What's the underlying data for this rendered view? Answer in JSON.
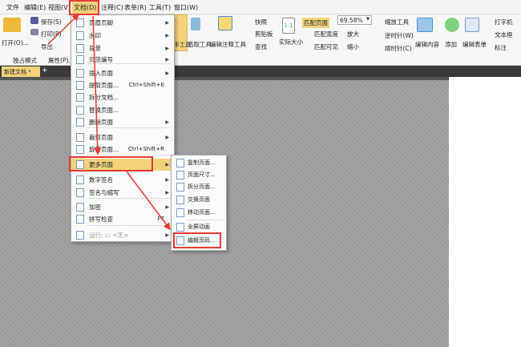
{
  "menubar": [
    "文件",
    "编辑(E)",
    "视图(V)",
    "文档(D)",
    "注释(C)",
    "表单(R)",
    "工具(T)",
    "窗口(W)"
  ],
  "ribbon": {
    "open": "打开(O)...",
    "save": "保存(S)",
    "print": "打印(P)",
    "export": "导出",
    "exclusive": "独占模式",
    "properties": "属性(P)...",
    "hand": "手工具",
    "select": "选取工具",
    "edit_annot": "编辑注释工具",
    "snapshot": "快照",
    "clipboard": "剪贴板",
    "find": "查找",
    "actual": "实际大小",
    "fit_page": "匹配页面",
    "fit_width": "匹配宽度",
    "fit_visible": "匹配可见",
    "zoom": "69.58%",
    "zoom_in": "放大",
    "zoom_out": "缩小",
    "zoom_tool": "缩放工具",
    "ccw": "逆时针(W)",
    "cw": "顺时针(C)",
    "edit_content": "编辑内容",
    "add": "添加",
    "edit_form": "编辑表单",
    "typewriter": "打字机",
    "textbox": "文本框",
    "callout": "标注"
  },
  "tab": {
    "label": "新建文档 *",
    "add": "+"
  },
  "doc_menu": [
    {
      "label": "页眉页脚",
      "arrow": true
    },
    {
      "label": "水印",
      "arrow": true
    },
    {
      "label": "背景",
      "arrow": true
    },
    {
      "label": "贝茨编号",
      "arrow": true
    },
    {
      "label": "插入页面",
      "arrow": true
    },
    {
      "label": "提取页面...",
      "shortcut": "Ctrl+Shift+E"
    },
    {
      "label": "拆分文档..."
    },
    {
      "label": "替换页面..."
    },
    {
      "label": "删除页面",
      "arrow": true
    },
    {
      "label": "裁剪页面",
      "arrow": true
    },
    {
      "label": "旋转页面...",
      "shortcut": "Ctrl+Shift+R"
    },
    {
      "label": "更多页面",
      "arrow": true
    },
    {
      "label": "数字签名",
      "arrow": true
    },
    {
      "label": "签名与缩写",
      "arrow": true
    },
    {
      "label": "加密",
      "arrow": true
    },
    {
      "label": "拼写检查",
      "shortcut": "F7"
    },
    {
      "label": "运行: ▭ <无>",
      "arrow": true
    }
  ],
  "sub_menu": [
    {
      "label": "复制页面..."
    },
    {
      "label": "页面尺寸..."
    },
    {
      "label": "拆分页面..."
    },
    {
      "label": "交换页面"
    },
    {
      "label": "移动页面..."
    },
    {
      "label": "全屏动画"
    },
    {
      "label": "编辑页码..."
    }
  ],
  "colors": {
    "highlight": "#f3d27a",
    "annotation": "#e53935"
  }
}
